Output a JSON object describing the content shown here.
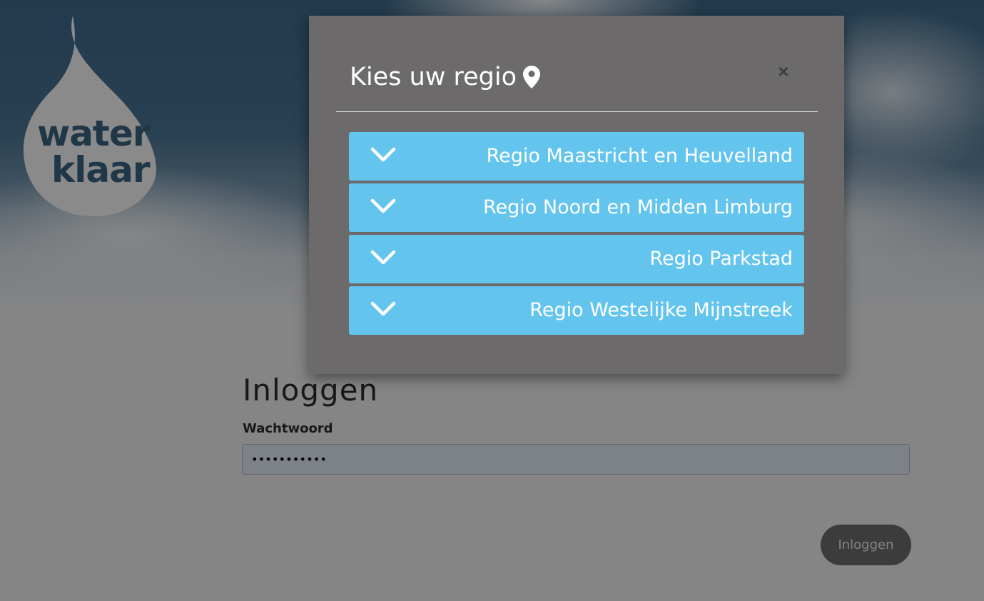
{
  "logo": {
    "line1": "water",
    "line2": "klaar"
  },
  "login": {
    "title": "Inloggen",
    "password_label": "Wachtwoord",
    "password_value": "•••••••••••",
    "submit_label": "Inloggen"
  },
  "modal": {
    "title": "Kies uw regio",
    "title_icon": "map-pin-icon",
    "close_label": "×",
    "regions": [
      {
        "label": "Regio Maastricht en Heuvelland",
        "icon": "chevron-down-icon"
      },
      {
        "label": "Regio Noord en Midden Limburg",
        "icon": "chevron-down-icon"
      },
      {
        "label": "Regio Parkstad",
        "icon": "chevron-down-icon"
      },
      {
        "label": "Regio Westelijke Mijnstreek",
        "icon": "chevron-down-icon"
      }
    ]
  },
  "colors": {
    "region_button": "#63c4ee",
    "modal_background": "#6c6a6a",
    "logo_text": "#3b6686",
    "login_button": "#707070"
  }
}
